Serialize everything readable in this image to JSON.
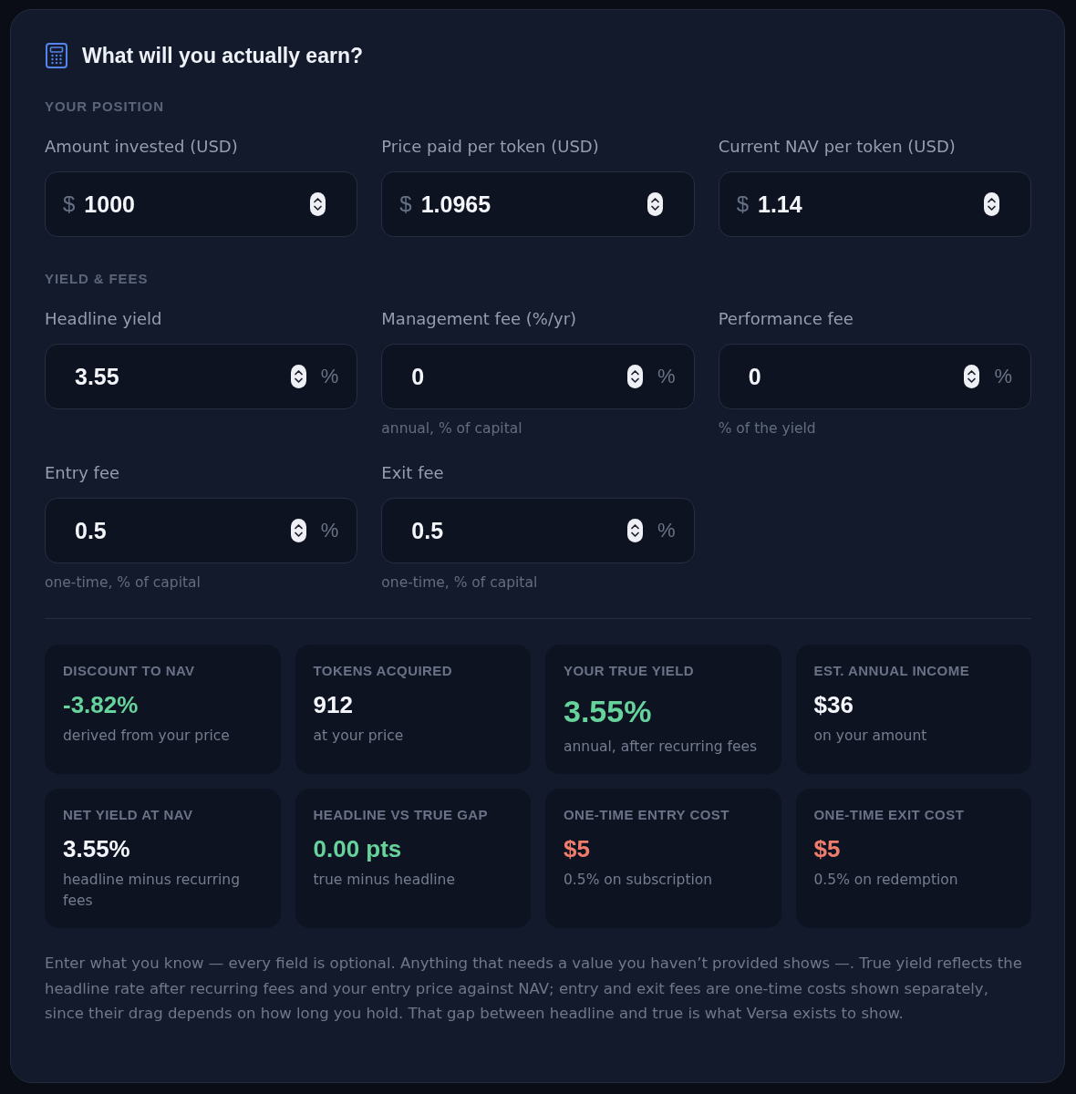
{
  "title": "What will you actually earn?",
  "sections": [
    {
      "heading": "YOUR POSITION",
      "fields": [
        {
          "label": "Amount invested (USD)",
          "prefix": "$",
          "value": "1000"
        },
        {
          "label": "Price paid per token (USD)",
          "prefix": "$",
          "value": "1.0965"
        },
        {
          "label": "Current NAV per token (USD)",
          "prefix": "$",
          "value": "1.14"
        }
      ]
    },
    {
      "heading": "YIELD & FEES",
      "fields": [
        {
          "label": "Headline yield",
          "value": "3.55",
          "suffix": "%"
        },
        {
          "label": "Management fee (%/yr)",
          "value": "0",
          "suffix": "%",
          "hint": "annual, % of capital"
        },
        {
          "label": "Performance fee",
          "value": "0",
          "suffix": "%",
          "hint": "% of the yield"
        },
        {
          "label": "Entry fee",
          "value": "0.5",
          "suffix": "%",
          "hint": "one-time, % of capital"
        },
        {
          "label": "Exit fee",
          "value": "0.5",
          "suffix": "%",
          "hint": "one-time, % of capital"
        }
      ]
    }
  ],
  "stats": [
    {
      "label": "DISCOUNT TO NAV",
      "value": "-3.82%",
      "color": "#66d39c",
      "featured": false,
      "note": "derived from your price"
    },
    {
      "label": "TOKENS ACQUIRED",
      "value": "912",
      "color": "#f3f5fa",
      "featured": false,
      "note": "at your price"
    },
    {
      "label": "YOUR TRUE YIELD",
      "value": "3.55%",
      "color": "#66d39c",
      "featured": true,
      "note": "annual, after recurring fees"
    },
    {
      "label": "EST. ANNUAL INCOME",
      "value": "$36",
      "color": "#f3f5fa",
      "featured": false,
      "note": "on your amount"
    },
    {
      "label": "NET YIELD AT NAV",
      "value": "3.55%",
      "color": "#f3f5fa",
      "featured": false,
      "note": "headline minus recurring fees"
    },
    {
      "label": "HEADLINE VS TRUE GAP",
      "value": "0.00 pts",
      "color": "#66d39c",
      "featured": false,
      "note": "true minus headline"
    },
    {
      "label": "ONE-TIME ENTRY COST",
      "value": "$5",
      "color": "#f07c6c",
      "featured": false,
      "note": "0.5% on subscription"
    },
    {
      "label": "ONE-TIME EXIT COST",
      "value": "$5",
      "color": "#f07c6c",
      "featured": false,
      "note": "0.5% on redemption"
    }
  ],
  "footnote": "Enter what you know — every field is optional. Anything that needs a value you haven’t provided shows —. True yield reflects the headline rate after recurring fees and your entry price against NAV; entry and exit fees are one-time costs shown separately, since their drag depends on how long you hold. That gap between headline and true is what Versa exists to show."
}
